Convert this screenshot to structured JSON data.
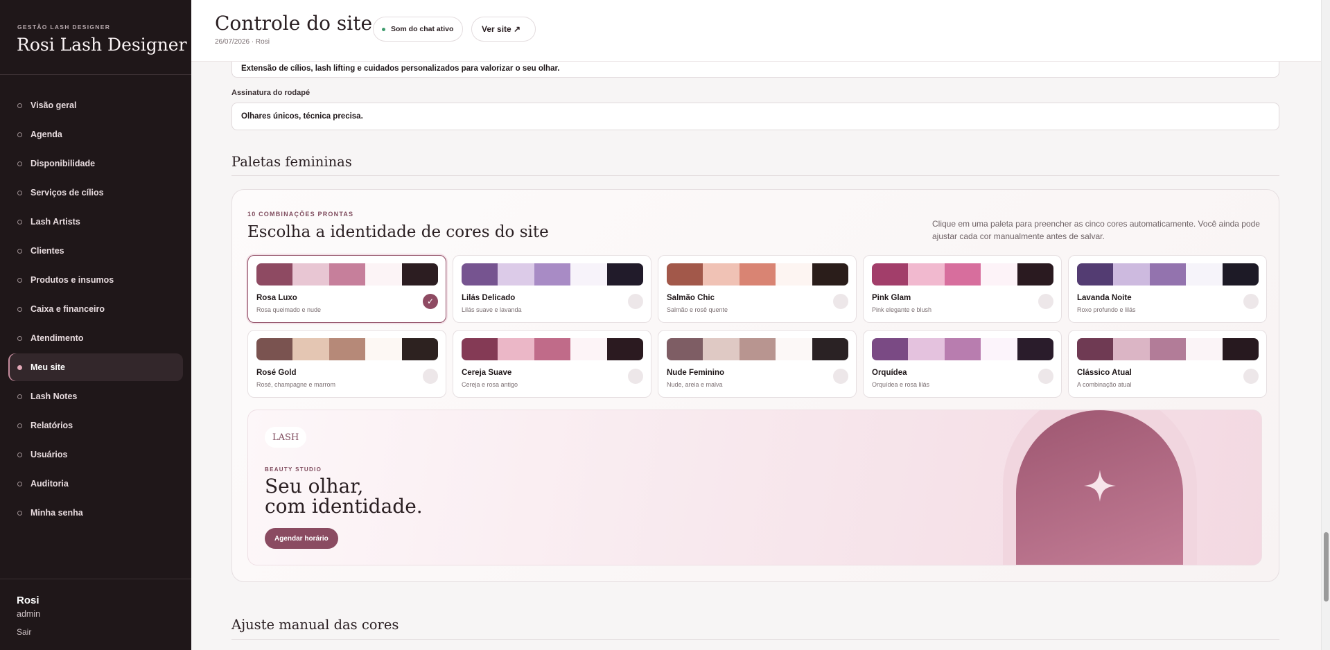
{
  "sidebar": {
    "kicker": "GESTÃO LASH DESIGNER",
    "title": "Rosi Lash Designer",
    "items": [
      {
        "label": "Visão geral"
      },
      {
        "label": "Agenda"
      },
      {
        "label": "Disponibilidade"
      },
      {
        "label": "Serviços de cílios"
      },
      {
        "label": "Lash Artists"
      },
      {
        "label": "Clientes"
      },
      {
        "label": "Produtos e insumos"
      },
      {
        "label": "Caixa e financeiro"
      },
      {
        "label": "Atendimento"
      },
      {
        "label": "Meu site",
        "active": true
      },
      {
        "label": "Lash Notes"
      },
      {
        "label": "Relatórios"
      },
      {
        "label": "Usuários"
      },
      {
        "label": "Auditoria"
      },
      {
        "label": "Minha senha"
      }
    ],
    "user": {
      "name": "Rosi",
      "role": "admin",
      "logout": "Sair"
    }
  },
  "header": {
    "title": "Controle do site",
    "subtitle": "26/07/2026 · Rosi",
    "sound_chip": "Som do chat ativo",
    "view_site": "Ver site ↗"
  },
  "form": {
    "description_value": "Extensão de cílios, lash lifting e cuidados personalizados para valorizar o seu olhar.",
    "footer_label": "Assinatura do rodapé",
    "footer_value": "Olhares únicos, técnica precisa."
  },
  "palettes_section": {
    "title": "Paletas femininas",
    "kicker": "10 COMBINAÇÕES PRONTAS",
    "heading": "Escolha a identidade de cores do site",
    "help": "Clique em uma paleta para preencher as cinco cores automaticamente. Você ainda pode ajustar cada cor manualmente antes de salvar.",
    "selected_mark": "✓",
    "palettes": [
      {
        "name": "Rosa Luxo",
        "desc": "Rosa queimado e nude",
        "colors": [
          "#8e4a62",
          "#e8c6d3",
          "#c67f9b",
          "#fcf4f6",
          "#2c1d21"
        ],
        "selected": true
      },
      {
        "name": "Lilás Delicado",
        "desc": "Lilás suave e lavanda",
        "colors": [
          "#765490",
          "#dccbe8",
          "#a88bc5",
          "#f7f3fa",
          "#211b2a"
        ]
      },
      {
        "name": "Salmão Chic",
        "desc": "Salmão e rosê quente",
        "colors": [
          "#a2584a",
          "#f0c2b5",
          "#d98473",
          "#fdf5f2",
          "#2a1d1a"
        ]
      },
      {
        "name": "Pink Glam",
        "desc": "Pink elegante e blush",
        "colors": [
          "#a23e6a",
          "#f1b9cf",
          "#d76e9d",
          "#fdf3f8",
          "#2a1a20"
        ]
      },
      {
        "name": "Lavanda Noite",
        "desc": "Roxo profundo e lilás",
        "colors": [
          "#533c72",
          "#cdbadf",
          "#9373ae",
          "#f6f4fa",
          "#1d1a26"
        ]
      },
      {
        "name": "Rosé Gold",
        "desc": "Rosé, champagne e marrom",
        "colors": [
          "#7a5350",
          "#e4c6b3",
          "#b68978",
          "#fdf8f4",
          "#2d2220"
        ]
      },
      {
        "name": "Cereja Suave",
        "desc": "Cereja e rosa antigo",
        "colors": [
          "#843a55",
          "#ebb7c7",
          "#c06b89",
          "#fdf4f7",
          "#2b1a20"
        ]
      },
      {
        "name": "Nude Feminino",
        "desc": "Nude, areia e malva",
        "colors": [
          "#7e5d64",
          "#dfc9c4",
          "#b89590",
          "#fcf8f7",
          "#2a2224"
        ]
      },
      {
        "name": "Orquídea",
        "desc": "Orquídea e rosa lilás",
        "colors": [
          "#7a4a84",
          "#e4c2de",
          "#b87daf",
          "#fcf4fb",
          "#2a1c2b"
        ]
      },
      {
        "name": "Clássico Atual",
        "desc": "A combinação atual",
        "colors": [
          "#6f3a53",
          "#dbb5c5",
          "#b27c98",
          "#fbf4f7",
          "#27191f"
        ]
      }
    ]
  },
  "preview": {
    "logo": "LASH",
    "kicker": "BEAUTY STUDIO",
    "title_line1": "Seu olhar,",
    "title_line2": "com identidade.",
    "button": "Agendar horário"
  },
  "manual_section": {
    "title": "Ajuste manual das cores"
  }
}
